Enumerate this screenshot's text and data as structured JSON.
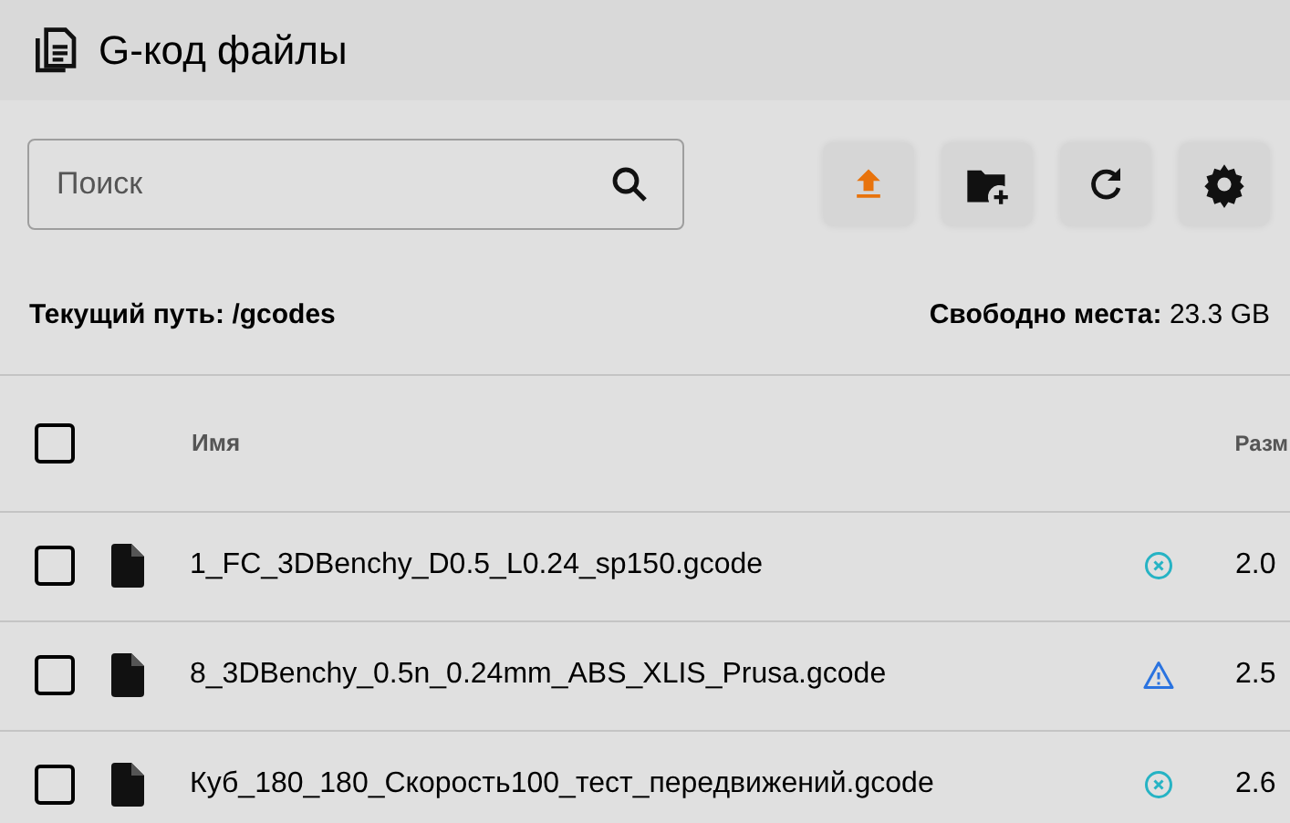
{
  "header": {
    "title": "G-код файлы"
  },
  "search": {
    "placeholder": "Поиск"
  },
  "path": {
    "label": "Текущий путь:",
    "value": "/gcodes"
  },
  "free_space": {
    "label": "Свободно места:",
    "value": "23.3 GB"
  },
  "table": {
    "select_all": {
      "checked": false
    },
    "columns": [
      "Имя",
      "Разм"
    ],
    "rows": [
      {
        "checked": false,
        "name": "1_FC_3DBenchy_D0.5_L0.24_sp150.gcode",
        "kind": "cancelled",
        "size": "2.0"
      },
      {
        "checked": false,
        "name": "8_3DBenchy_0.5n_0.24mm_ABS_XLIS_Prusa.gcode",
        "kind": "warning",
        "size": "2.5"
      },
      {
        "checked": false,
        "name": "Куб_180_180_Скорость100_тест_передвижений.gcode",
        "kind": "cancelled",
        "size": "2.6"
      }
    ]
  }
}
